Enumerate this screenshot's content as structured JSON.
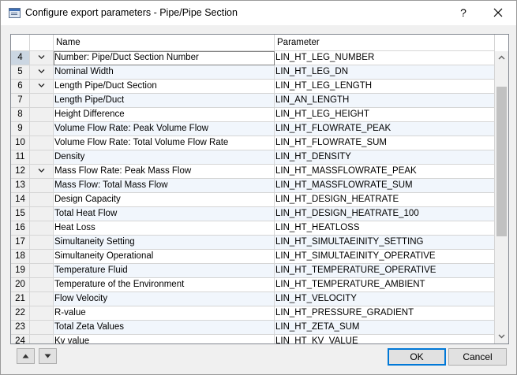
{
  "window": {
    "title": "Configure export parameters - Pipe/Pipe Section",
    "help_label": "?"
  },
  "table": {
    "headers": {
      "index": "",
      "check": "",
      "name": "Name",
      "parameter": "Parameter"
    },
    "rows": [
      {
        "num": "4",
        "checked": true,
        "name": "Number: Pipe/Duct Section Number",
        "param": "LIN_HT_LEG_NUMBER"
      },
      {
        "num": "5",
        "checked": true,
        "name": "Nominal Width",
        "param": "LIN_HT_LEG_DN"
      },
      {
        "num": "6",
        "checked": true,
        "name": "Length Pipe/Duct Section",
        "param": "LIN_HT_LEG_LENGTH"
      },
      {
        "num": "7",
        "checked": false,
        "name": "Length Pipe/Duct",
        "param": "LIN_AN_LENGTH"
      },
      {
        "num": "8",
        "checked": false,
        "name": "Height Difference",
        "param": "LIN_HT_LEG_HEIGHT"
      },
      {
        "num": "9",
        "checked": false,
        "name": "Volume Flow Rate: Peak Volume Flow",
        "param": "LIN_HT_FLOWRATE_PEAK"
      },
      {
        "num": "10",
        "checked": false,
        "name": "Volume Flow Rate: Total Volume Flow Rate",
        "param": "LIN_HT_FLOWRATE_SUM"
      },
      {
        "num": "11",
        "checked": false,
        "name": "Density",
        "param": "LIN_HT_DENSITY"
      },
      {
        "num": "12",
        "checked": true,
        "name": "Mass Flow Rate: Peak Mass Flow",
        "param": "LIN_HT_MASSFLOWRATE_PEAK"
      },
      {
        "num": "13",
        "checked": false,
        "name": "Mass Flow: Total Mass Flow",
        "param": "LIN_HT_MASSFLOWRATE_SUM"
      },
      {
        "num": "14",
        "checked": false,
        "name": "Design Capacity",
        "param": "LIN_HT_DESIGN_HEATRATE"
      },
      {
        "num": "15",
        "checked": false,
        "name": "Total Heat Flow",
        "param": "LIN_HT_DESIGN_HEATRATE_100"
      },
      {
        "num": "16",
        "checked": false,
        "name": "Heat Loss",
        "param": "LIN_HT_HEATLOSS"
      },
      {
        "num": "17",
        "checked": false,
        "name": "Simultaneity Setting",
        "param": "LIN_HT_SIMULTAEINITY_SETTING"
      },
      {
        "num": "18",
        "checked": false,
        "name": "Simultaneity Operational",
        "param": "LIN_HT_SIMULTAEINITY_OPERATIVE"
      },
      {
        "num": "19",
        "checked": false,
        "name": "Temperature Fluid",
        "param": "LIN_HT_TEMPERATURE_OPERATIVE"
      },
      {
        "num": "20",
        "checked": false,
        "name": "Temperature of the Environment",
        "param": "LIN_HT_TEMPERATURE_AMBIENT"
      },
      {
        "num": "21",
        "checked": false,
        "name": "Flow Velocity",
        "param": "LIN_HT_VELOCITY"
      },
      {
        "num": "22",
        "checked": false,
        "name": "R-value",
        "param": "LIN_HT_PRESSURE_GRADIENT"
      },
      {
        "num": "23",
        "checked": false,
        "name": "Total Zeta Values",
        "param": "LIN_HT_ZETA_SUM"
      },
      {
        "num": "24",
        "checked": false,
        "name": "Kv value",
        "param": "LIN_HT_KV_VALUE"
      }
    ]
  },
  "buttons": {
    "ok": "OK",
    "cancel": "Cancel"
  },
  "colors": {
    "accent": "#0078d7",
    "row_alt": "#f1f6fc",
    "current_row_header": "#cbd6e2"
  }
}
